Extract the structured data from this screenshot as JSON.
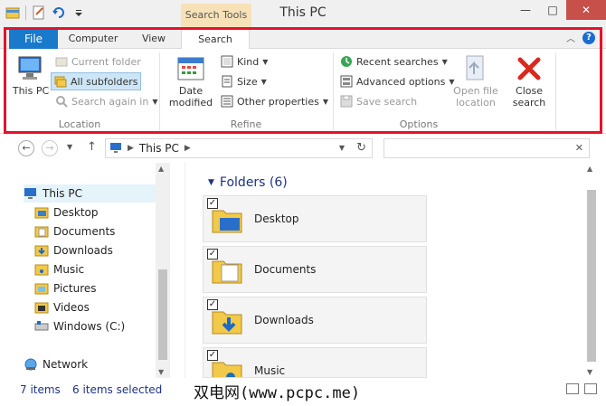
{
  "window": {
    "title": "This PC",
    "contextual_tab": "Search Tools",
    "accent_color": "#1979ca",
    "highlight_color": "#e8112d"
  },
  "titlebar_buttons": {
    "minimize": "—",
    "maximize": "□",
    "close": "✕"
  },
  "tabs": {
    "file": "File",
    "computer": "Computer",
    "view": "View",
    "search": "Search",
    "help": "?"
  },
  "ribbon": {
    "location": {
      "label": "Location",
      "this_pc": "This PC",
      "current_folder": "Current folder",
      "all_subfolders": "All subfolders",
      "search_again_in": "Search again in"
    },
    "refine": {
      "label": "Refine",
      "date_modified": "Date modified",
      "kind": "Kind",
      "size": "Size",
      "other_properties": "Other properties"
    },
    "options": {
      "label": "Options",
      "recent_searches": "Recent searches",
      "advanced_options": "Advanced options",
      "save_search": "Save search",
      "open_file_location": "Open file location",
      "close_search": "Close search"
    }
  },
  "address": {
    "path": "This PC",
    "search_placeholder": ""
  },
  "nav_pane": {
    "items": [
      {
        "label": "This PC",
        "icon": "computer-icon"
      },
      {
        "label": "Desktop",
        "icon": "folder-icon"
      },
      {
        "label": "Documents",
        "icon": "folder-icon"
      },
      {
        "label": "Downloads",
        "icon": "folder-icon"
      },
      {
        "label": "Music",
        "icon": "folder-icon"
      },
      {
        "label": "Pictures",
        "icon": "folder-icon"
      },
      {
        "label": "Videos",
        "icon": "folder-icon"
      },
      {
        "label": "Windows (C:)",
        "icon": "drive-icon"
      },
      {
        "label": "Network",
        "icon": "network-icon"
      }
    ]
  },
  "content": {
    "group_title": "Folders (6)",
    "folders": [
      {
        "name": "Desktop",
        "checked": true
      },
      {
        "name": "Documents",
        "checked": true
      },
      {
        "name": "Downloads",
        "checked": true
      },
      {
        "name": "Music",
        "checked": true
      }
    ]
  },
  "status": {
    "items_count": "7 items",
    "selected_count": "6 items selected",
    "watermark": "双电网(www.pcpc.me)"
  }
}
